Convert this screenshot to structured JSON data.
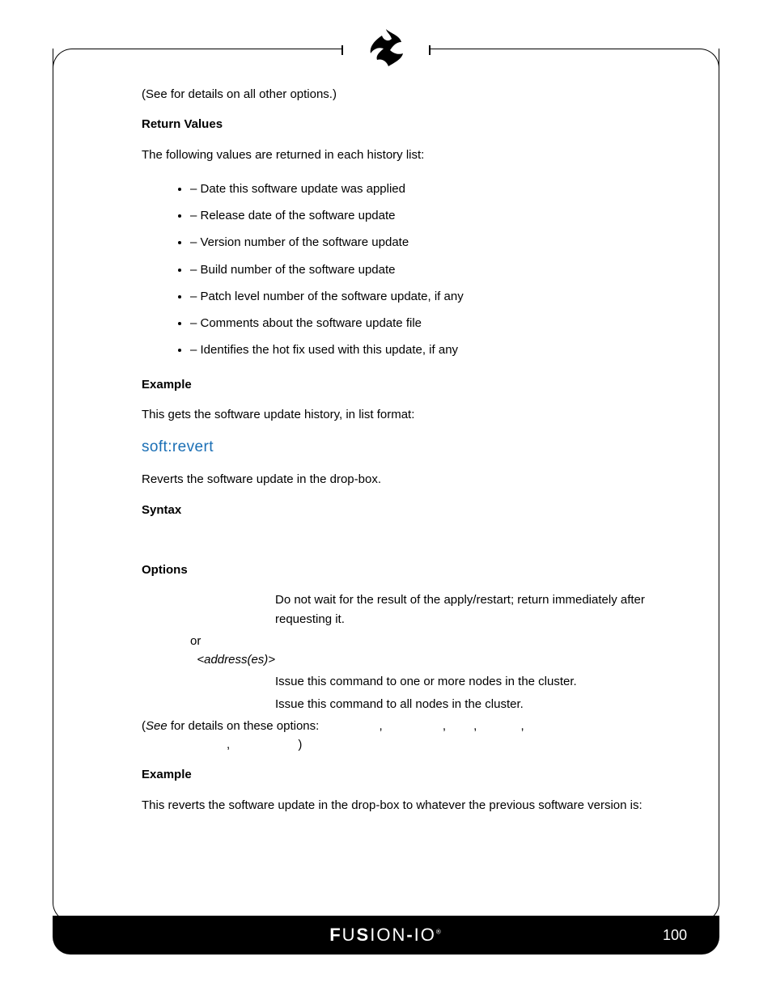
{
  "intro": {
    "pre": "(See ",
    "post": " for details on all other options.)"
  },
  "h_return": "Return Values",
  "return_desc": "The following values are returned in each history list:",
  "bullets": [
    " – Date this software update was applied",
    " – Release date of the software update",
    " – Version number of the software update",
    " – Build number of the software update",
    " – Patch level number of the software update, if any",
    " – Comments about the software update file",
    " – Identifies the hot fix used with this update, if any"
  ],
  "h_example1": "Example",
  "ex1_desc": "This gets the software update history, in list format:",
  "cmd_title": "soft:revert",
  "cmd_desc": "Reverts the software update in the drop-box.",
  "h_syntax": "Syntax",
  "h_options": "Options",
  "opt1_val": "Do not wait for the result of the apply/restart; return immediately after requesting it.",
  "opt2_key_or": " or ",
  "opt2_key_addr": "<address(es)>",
  "opt2_val": "Issue this command to one or more nodes in the cluster.",
  "opt3_val": "Issue this command to all nodes in the cluster.",
  "see": {
    "pre": "(",
    "see": "See ",
    "mid": " for details on these options: ",
    "tail": ", ",
    "close": ")"
  },
  "h_example2": "Example",
  "ex2_desc": "This reverts the software update in the drop-box to whatever the previous software version is:",
  "footer": {
    "brand": "FUSiON-iO",
    "page": "100"
  }
}
